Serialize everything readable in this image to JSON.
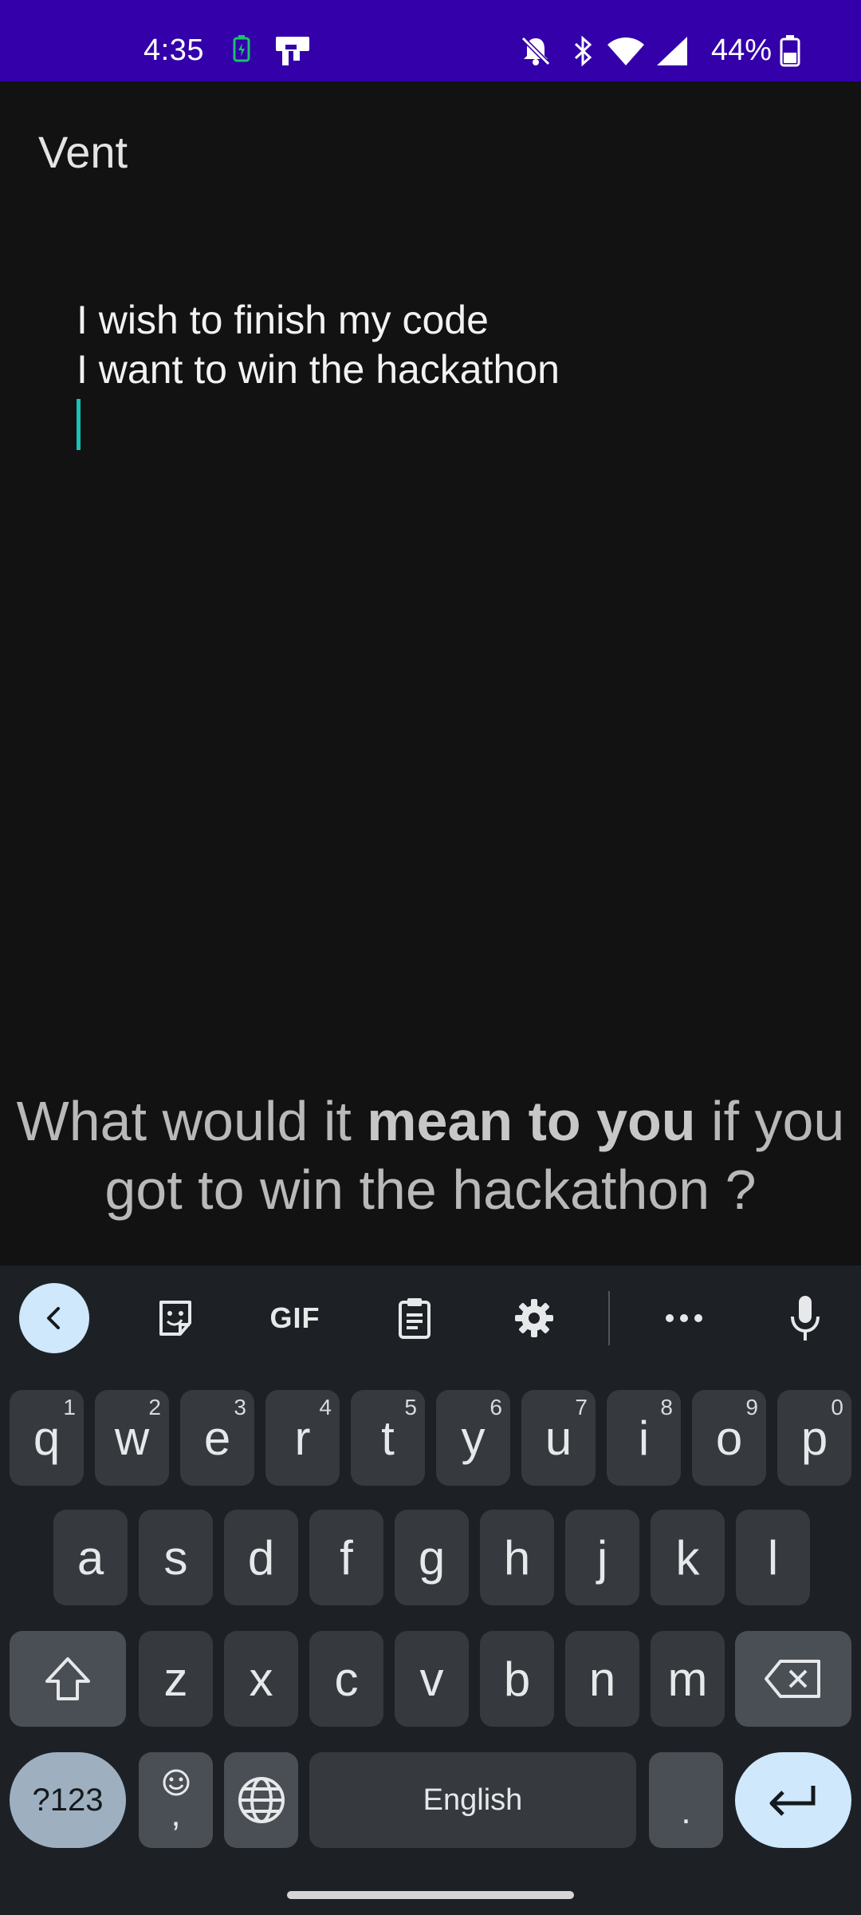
{
  "status_bar": {
    "time": "4:35",
    "battery_percent": "44%",
    "icons": [
      "battery-saver-icon",
      "cast-icon",
      "do-not-disturb-icon",
      "bluetooth-icon",
      "wifi-icon",
      "signal-icon",
      "battery-icon"
    ]
  },
  "app": {
    "title": "Vent"
  },
  "editor": {
    "lines": [
      "I wish to finish my code",
      "I want to win the hackathon"
    ]
  },
  "prompt": {
    "part1": "What would it ",
    "bold": "mean to you",
    "part2": " if you got to win the hackathon ?"
  },
  "keyboard": {
    "toolbar": [
      "back-icon",
      "sticker-icon",
      "gif-icon",
      "clipboard-icon",
      "settings-icon",
      "more-icon",
      "mic-icon"
    ],
    "gif_label": "GIF",
    "row1": [
      {
        "key": "q",
        "hint": "1"
      },
      {
        "key": "w",
        "hint": "2"
      },
      {
        "key": "e",
        "hint": "3"
      },
      {
        "key": "r",
        "hint": "4"
      },
      {
        "key": "t",
        "hint": "5"
      },
      {
        "key": "y",
        "hint": "6"
      },
      {
        "key": "u",
        "hint": "7"
      },
      {
        "key": "i",
        "hint": "8"
      },
      {
        "key": "o",
        "hint": "9"
      },
      {
        "key": "p",
        "hint": "0"
      }
    ],
    "row2": [
      "a",
      "s",
      "d",
      "f",
      "g",
      "h",
      "j",
      "k",
      "l"
    ],
    "row3": [
      "z",
      "x",
      "c",
      "v",
      "b",
      "n",
      "m"
    ],
    "symbols_label": "?123",
    "comma_label": ",",
    "space_label": "English",
    "period_label": "."
  },
  "colors": {
    "status_bar": "#3300aa",
    "background": "#121212",
    "caret": "#19c2b2",
    "keyboard_bg": "#1d2126",
    "accent_key": "#cfe8fb"
  }
}
